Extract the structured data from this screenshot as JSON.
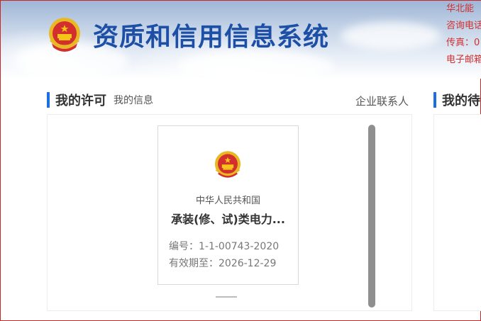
{
  "header": {
    "system_title": "资质和信用信息系统",
    "contact_lines": [
      "华北能",
      "咨询电话",
      "传真：0",
      "电子邮箱"
    ],
    "emblem_icon": "national-emblem-icon"
  },
  "sections": {
    "my_license": {
      "title": "我的许可",
      "tab_my_info": "我的信息",
      "enterprise_contact": "企业联系人"
    },
    "my_pending": {
      "title": "我的待"
    }
  },
  "license_card": {
    "emblem_icon": "national-emblem-icon",
    "country": "中华人民共和国",
    "name": "承装(修、试)类电力...",
    "number_line": "编号：1-1-00743-2020",
    "expiry_line": "有效期至：2026-12-29"
  },
  "colors": {
    "title_blue": "#1c4fa5",
    "accent_bar": "#1c6fe0",
    "contact_red": "#d32f2f"
  }
}
